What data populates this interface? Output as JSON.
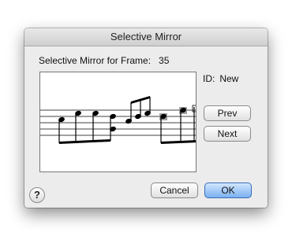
{
  "window": {
    "title": "Selective Mirror"
  },
  "frame": {
    "label": "Selective Mirror for Frame:",
    "number": "35"
  },
  "id": {
    "label": "ID:",
    "value": "New"
  },
  "buttons": {
    "prev": "Prev",
    "next": "Next",
    "cancel": "Cancel",
    "ok": "OK",
    "help": "?"
  },
  "preview": {
    "content": "music-notation-staff",
    "colors": {
      "staff": "#000000",
      "notes": "#000000",
      "selection": "#a0a0a0"
    }
  }
}
